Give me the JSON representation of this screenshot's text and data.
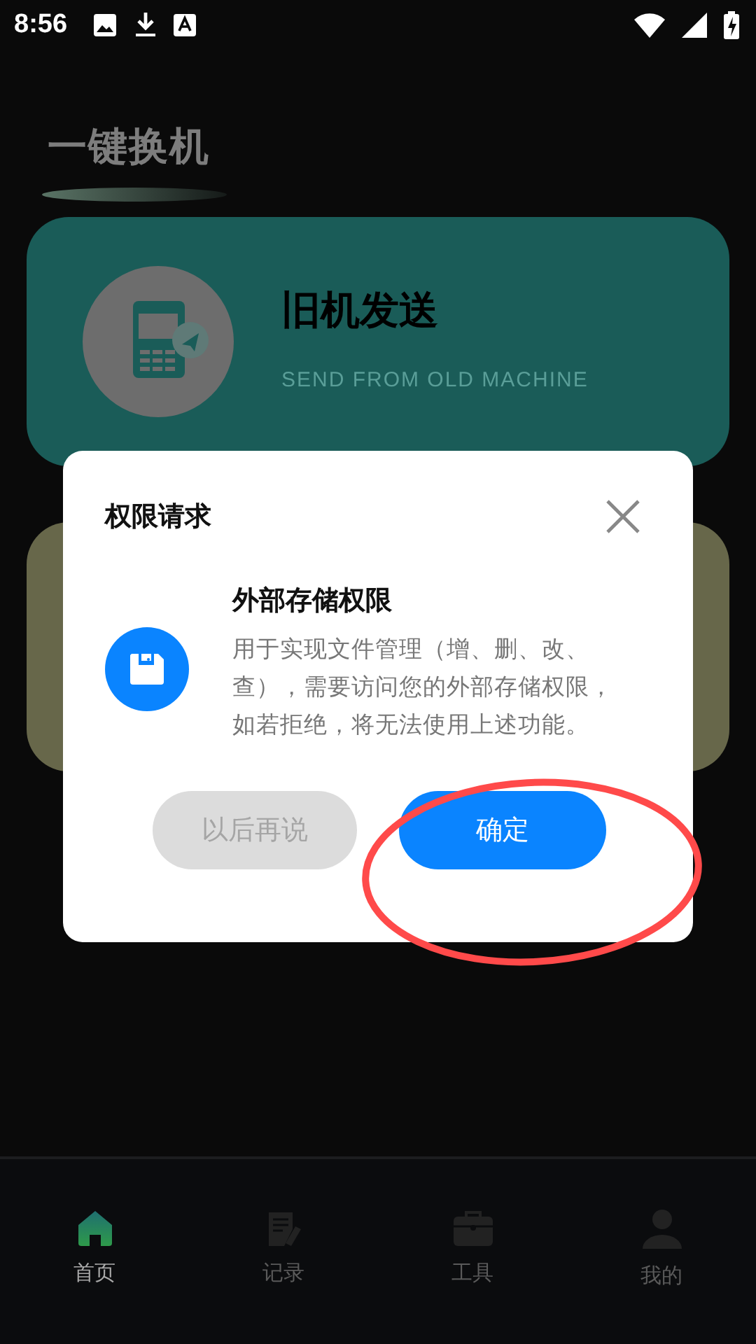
{
  "status_bar": {
    "time": "8:56"
  },
  "header": {
    "title": "一键换机"
  },
  "cards": [
    {
      "kind": "send",
      "title": "旧机发送",
      "subtitle": "SEND FROM OLD MACHINE",
      "color": "#1a5c58"
    },
    {
      "kind": "blank",
      "color": "#67674a"
    }
  ],
  "dialog": {
    "title": "权限请求",
    "permission_title": "外部存储权限",
    "description": "用于实现文件管理（增、删、改、查），需要访问您的外部存储权限，如若拒绝，将无法使用上述功能。",
    "buttons": [
      {
        "label": "以后再说",
        "kind": "secondary"
      },
      {
        "label": "确定",
        "kind": "primary"
      }
    ]
  },
  "bottom_nav": [
    {
      "label": "首页",
      "selected": true
    },
    {
      "label": "记录",
      "selected": false
    },
    {
      "label": "工具",
      "selected": false
    },
    {
      "label": "我的",
      "selected": false
    }
  ]
}
